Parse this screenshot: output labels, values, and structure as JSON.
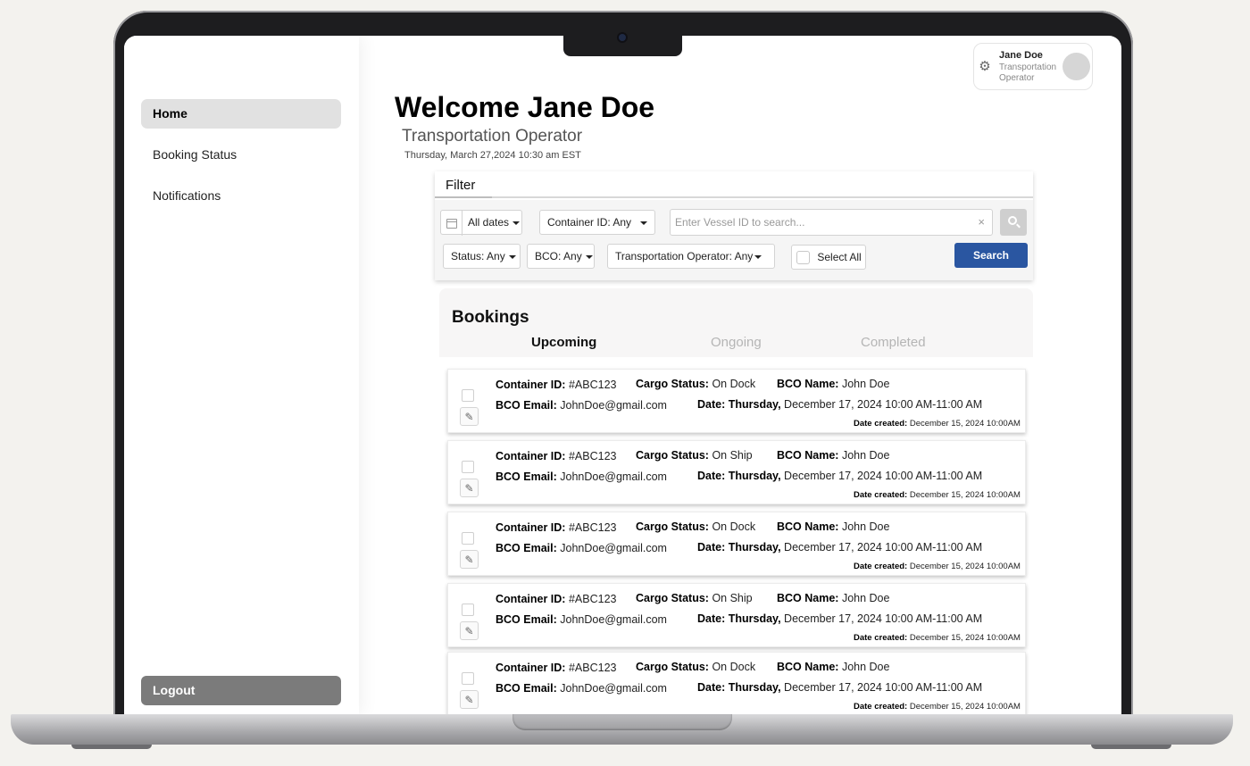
{
  "sidebar": {
    "items": [
      {
        "label": "Home",
        "active": true
      },
      {
        "label": "Booking Status",
        "active": false
      },
      {
        "label": "Notifications",
        "active": false
      }
    ],
    "logout_label": "Logout"
  },
  "header": {
    "title": "Welcome Jane Doe",
    "subtitle": "Transportation Operator",
    "datetime": "Thursday, March 27,2024 10:30 am EST"
  },
  "user_card": {
    "name": "Jane Doe",
    "role": "Transportation Operator",
    "icon": "gear-icon"
  },
  "filter": {
    "title": "Filter",
    "dates": "All dates",
    "container_id": "Container ID: Any",
    "vessel_placeholder": "Enter Vessel ID to search...",
    "clear_symbol": "×",
    "status": "Status: Any",
    "bco": "BCO: Any",
    "transport_operator": "Transportation Operator: Any",
    "select_all": "Select All",
    "search_label": "Search"
  },
  "bookings": {
    "title": "Bookings",
    "tabs": [
      "Upcoming",
      "Ongoing",
      "Completed"
    ],
    "active_tab": "Upcoming",
    "labels": {
      "container_id": "Container ID:",
      "cargo_status": "Cargo Status:",
      "bco_name": "BCO Name:",
      "bco_email": "BCO Email:",
      "date": "Date:",
      "date_created": "Date created:"
    },
    "rows": [
      {
        "container_id": "#ABC123",
        "cargo_status": "On Dock",
        "bco_name": "John Doe",
        "bco_email": "JohnDoe@gmail.com",
        "day": "Thursday,",
        "date": "December 17, 2024 10:00 AM-11:00 AM",
        "created": "December 15, 2024 10:00AM"
      },
      {
        "container_id": "#ABC123",
        "cargo_status": "On Ship",
        "bco_name": "John Doe",
        "bco_email": "JohnDoe@gmail.com",
        "day": "Thursday,",
        "date": "December 17, 2024 10:00 AM-11:00 AM",
        "created": "December 15, 2024 10:00AM"
      },
      {
        "container_id": "#ABC123",
        "cargo_status": "On Dock",
        "bco_name": "John Doe",
        "bco_email": "JohnDoe@gmail.com",
        "day": "Thursday,",
        "date": "December 17, 2024 10:00 AM-11:00 AM",
        "created": "December 15, 2024 10:00AM"
      },
      {
        "container_id": "#ABC123",
        "cargo_status": "On Ship",
        "bco_name": "John Doe",
        "bco_email": "JohnDoe@gmail.com",
        "day": "Thursday,",
        "date": "December 17, 2024 10:00 AM-11:00 AM",
        "created": "December 15, 2024 10:00AM"
      },
      {
        "container_id": "#ABC123",
        "cargo_status": "On Dock",
        "bco_name": "John Doe",
        "bco_email": "JohnDoe@gmail.com",
        "day": "Thursday,",
        "date": "December 17, 2024 10:00 AM-11:00 AM",
        "created": "December 15, 2024 10:00AM"
      }
    ]
  },
  "colors": {
    "accent": "#2a56a1",
    "logout_bg": "#7b7b7b",
    "active_nav_bg": "#e1e1e1"
  }
}
